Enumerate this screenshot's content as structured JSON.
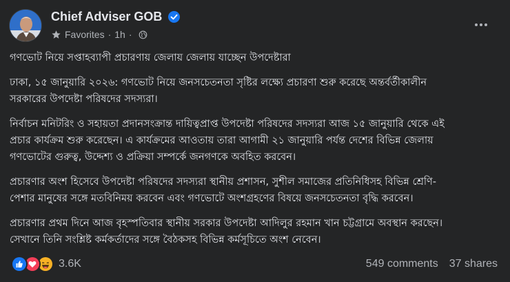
{
  "page": {
    "name": "Chief Adviser GOB",
    "verified": true,
    "audience": "Favorites",
    "time": "1h",
    "accent_color": "#1877f2"
  },
  "post": {
    "paragraphs": [
      "গণভোট নিয়ে সপ্তাহব্যাপী প্রচারণায় জেলায় জেলায় যাচ্ছেন উপদেষ্টারা",
      "ঢাকা, ১৫ জানুয়ারি ২০২৬: গণভোট নিয়ে জনসচেতনতা সৃষ্টির লক্ষ্যে প্রচারণা শুরু করেছে অন্তর্বর্তীকালীন\nসরকারের উপদেষ্টা পরিষদের সদস্যরা।",
      "নির্বাচন মনিটরিং ও সহায়তা প্রদানসংক্রান্ত দায়িত্বপ্রাপ্ত উপদেষ্টা পরিষদের সদস্যরা আজ ১৫ জানুয়ারি থেকে এই\nপ্রচার কার্যক্রম শুরু করেছেন। এ কার্যক্রমের আওতায় তারা আগামী ২১ জানুয়ারি পর্যন্ত দেশের বিভিন্ন জেলায়\nগণভোটের গুরুত্ব, উদ্দেশ্য ও প্রক্রিয়া সম্পর্কে জনগণকে অবহিত করবেন।",
      "প্রচারণার অংশ হিসেবে উপদেষ্টা পরিষদের সদস্যরা স্থানীয় প্রশাসন, সুশীল সমাজের প্রতিনিধিসহ বিভিন্ন শ্রেণি-\nপেশার মানুষের সঙ্গে মতবিনিময় করবেন এবং গণভোটে অংশগ্রহণের বিষয়ে জনসচেতনতা বৃদ্ধি করবেন।",
      "প্রচারণার প্রথম দিনে আজ বৃহস্পতিবার স্থানীয় সরকার উপদেষ্টা আদিলুর রহমান খান চট্টগ্রামে অবস্থান করছেন।\nসেখানে তিনি সংশ্লিষ্ট কর্মকর্তাদের সঙ্গে বৈঠকসহ বিভিন্ন কর্মসূচিতে অংশ নেবেন।"
    ]
  },
  "footer": {
    "reactions": [
      "like-icon",
      "love-icon",
      "haha-icon"
    ],
    "reaction_count": "3.6K",
    "comments": "549 comments",
    "shares": "37 shares"
  },
  "icons": {
    "audience": "star-icon",
    "privacy": "globe-icon",
    "menu": "more-options-icon",
    "badge": "verified-badge-icon"
  }
}
